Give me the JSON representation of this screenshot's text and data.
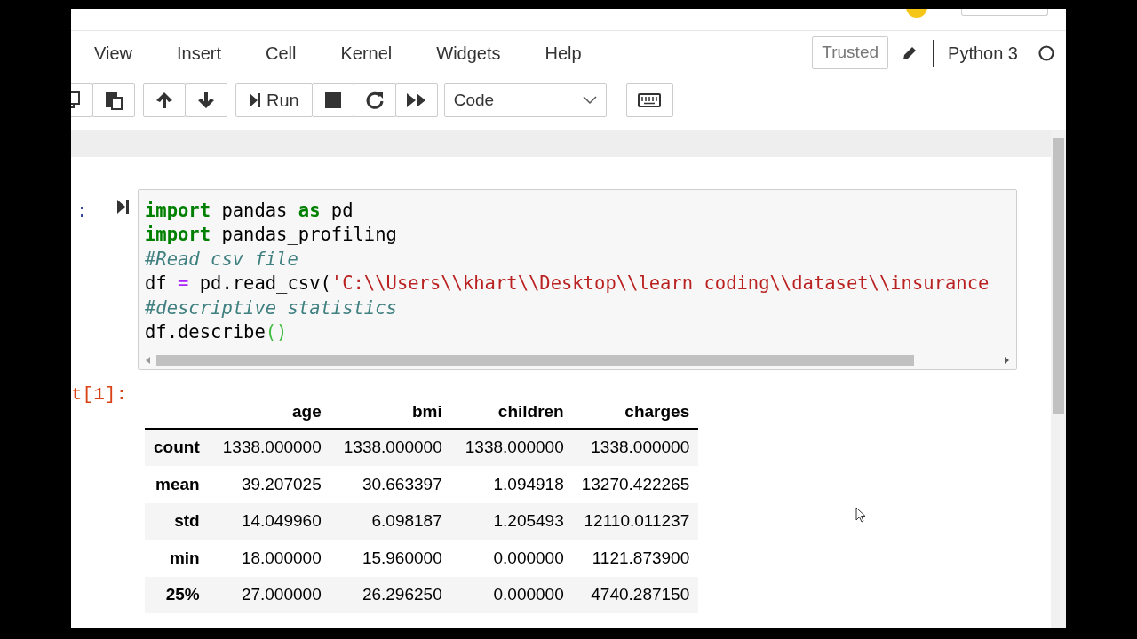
{
  "menu": [
    "View",
    "Insert",
    "Cell",
    "Kernel",
    "Widgets",
    "Help"
  ],
  "header": {
    "trusted": "Trusted",
    "kernel_name": "Python 3",
    "kernel_busy": false
  },
  "toolbar": {
    "run_label": "Run",
    "cell_type": "Code"
  },
  "cell": {
    "prompt": ":",
    "lines": [
      [
        {
          "kind": "keyword",
          "text": "import"
        },
        {
          "kind": "name",
          "text": " pandas "
        },
        {
          "kind": "keyword",
          "text": "as"
        },
        {
          "kind": "name",
          "text": " pd"
        }
      ],
      [
        {
          "kind": "keyword",
          "text": "import"
        },
        {
          "kind": "name",
          "text": " pandas_profiling"
        }
      ],
      [
        {
          "kind": "comment",
          "text": "#Read csv file"
        }
      ],
      [
        {
          "kind": "name",
          "text": "df "
        },
        {
          "kind": "operator",
          "text": "="
        },
        {
          "kind": "name",
          "text": " pd.read_csv("
        },
        {
          "kind": "string",
          "text": "'C:\\\\Users\\\\khart\\\\Desktop\\\\learn coding\\\\dataset\\\\insurance"
        }
      ],
      [
        {
          "kind": "comment",
          "text": "#descriptive statistics"
        }
      ],
      [
        {
          "kind": "name",
          "text": "df.describe"
        },
        {
          "kind": "paren",
          "text": "()"
        }
      ]
    ]
  },
  "output": {
    "prompt": "t[1]:",
    "columns": [
      "age",
      "bmi",
      "children",
      "charges"
    ],
    "rows": [
      {
        "label": "count",
        "values": [
          "1338.000000",
          "1338.000000",
          "1338.000000",
          "1338.000000"
        ]
      },
      {
        "label": "mean",
        "values": [
          "39.207025",
          "30.663397",
          "1.094918",
          "13270.422265"
        ]
      },
      {
        "label": "std",
        "values": [
          "14.049960",
          "6.098187",
          "1.205493",
          "12110.011237"
        ]
      },
      {
        "label": "min",
        "values": [
          "18.000000",
          "15.960000",
          "0.000000",
          "1121.873900"
        ]
      },
      {
        "label": "25%",
        "values": [
          "27.000000",
          "26.296250",
          "0.000000",
          "4740.287150"
        ]
      }
    ]
  }
}
